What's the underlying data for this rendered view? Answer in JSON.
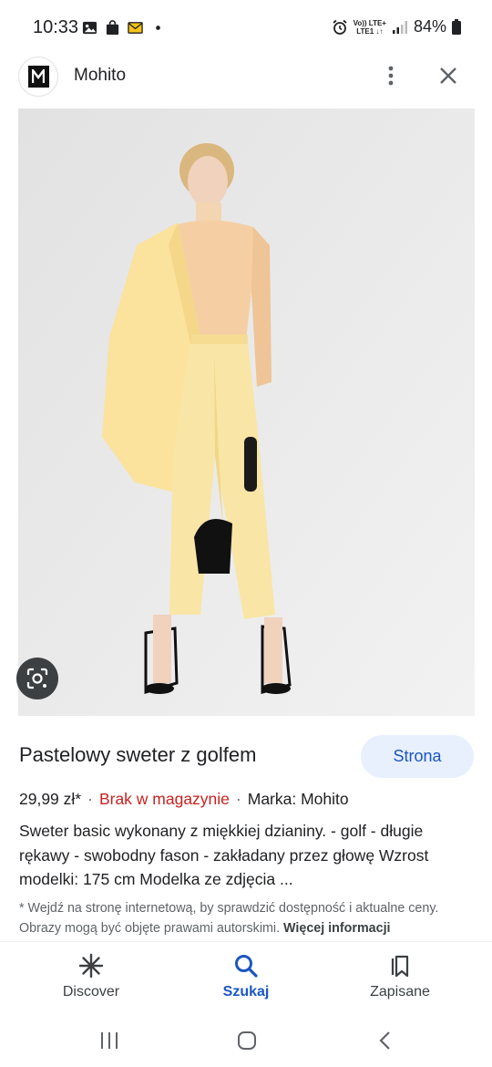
{
  "status_bar": {
    "time": "10:33",
    "left_icons": [
      "gallery-icon",
      "shopping-bag-icon",
      "mail-icon",
      "dot-icon"
    ],
    "network_top": "Vo)) LTE+",
    "network_bottom": "LTE1 ↓↑",
    "battery": "84%"
  },
  "header": {
    "logo_letter": "M",
    "site_name": "Mohito"
  },
  "product": {
    "image_alt": "Pastelowy sweter z golfem",
    "title": "Pastelowy sweter z golfem",
    "visit_label": "Strona",
    "price": "29,99 zł*",
    "stock": "Brak w magazynie",
    "brand": "Marka: Mohito",
    "description": "Sweter basic wykonany z miękkiej dzianiny. - golf - długie rękawy - swobodny fason - zakładany przez głowę Wzrost modelki: 175 cm Modelka ze zdjęcia ...",
    "disclaimer": "* Wejdź na stronę internetową, by sprawdzić dostępność i aktualne ceny. Obrazy mogą być objęte prawami autorskimi.",
    "more_info": "Więcej informacji"
  },
  "bottom_nav": {
    "discover": "Discover",
    "search": "Szukaj",
    "saved": "Zapisane"
  },
  "colors": {
    "accent": "#1a56c5",
    "stock_red": "#c5221f",
    "chip_bg": "#e8f0fe"
  }
}
